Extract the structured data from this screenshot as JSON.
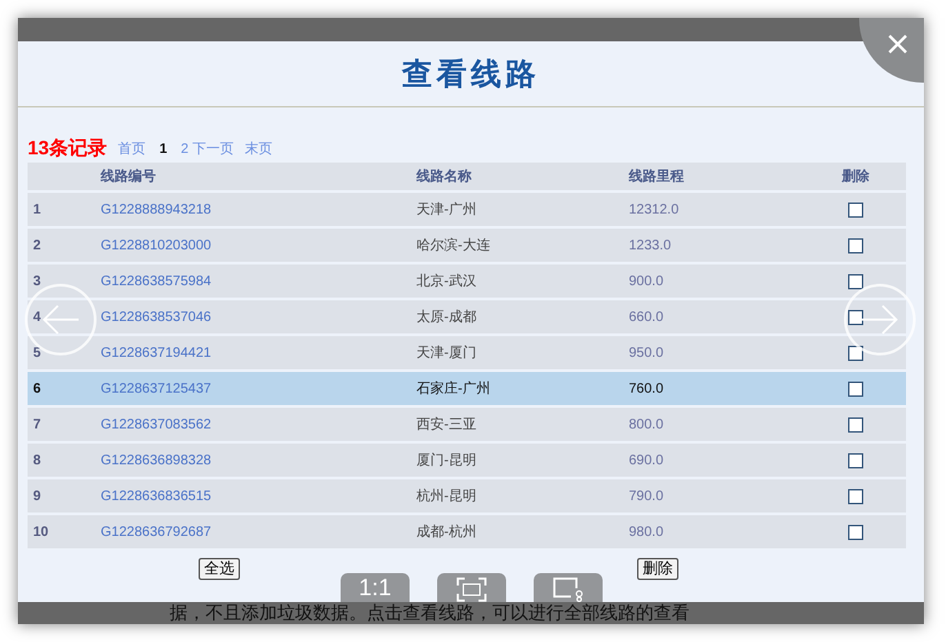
{
  "dialog": {
    "title": "查看线路"
  },
  "pagination": {
    "count": "13条记录",
    "links": [
      {
        "label": "首页",
        "selected": false
      },
      {
        "label": "1",
        "selected": true
      },
      {
        "label": "2 下一页",
        "selected": false
      },
      {
        "label": "末页",
        "selected": false
      }
    ]
  },
  "table": {
    "columns": [
      "",
      "线路编号",
      "线路名称",
      "线路里程",
      "删除"
    ],
    "rows": [
      {
        "index": "1",
        "code": "G1228888943218",
        "name": "天津-广州",
        "distance": "12312.0",
        "checked": false,
        "selected": false
      },
      {
        "index": "2",
        "code": "G1228810203000",
        "name": "哈尔滨-大连",
        "distance": "1233.0",
        "checked": false,
        "selected": false
      },
      {
        "index": "3",
        "code": "G1228638575984",
        "name": "北京-武汉",
        "distance": "900.0",
        "checked": false,
        "selected": false
      },
      {
        "index": "4",
        "code": "G1228638537046",
        "name": "太原-成都",
        "distance": "660.0",
        "checked": false,
        "selected": false
      },
      {
        "index": "5",
        "code": "G1228637194421",
        "name": "天津-厦门",
        "distance": "950.0",
        "checked": false,
        "selected": false
      },
      {
        "index": "6",
        "code": "G1228637125437",
        "name": "石家庄-广州",
        "distance": "760.0",
        "checked": false,
        "selected": true
      },
      {
        "index": "7",
        "code": "G1228637083562",
        "name": "西安-三亚",
        "distance": "800.0",
        "checked": false,
        "selected": false
      },
      {
        "index": "8",
        "code": "G1228636898328",
        "name": "厦门-昆明",
        "distance": "690.0",
        "checked": false,
        "selected": false
      },
      {
        "index": "9",
        "code": "G1228636836515",
        "name": "杭州-昆明",
        "distance": "790.0",
        "checked": false,
        "selected": false
      },
      {
        "index": "10",
        "code": "G1228636792687",
        "name": "成都-杭州",
        "distance": "980.0",
        "checked": false,
        "selected": false
      }
    ]
  },
  "buttons": {
    "select_all": "全选",
    "delete": "删除"
  },
  "viewer": {
    "actual_size": "1:1"
  },
  "background_text": "据，不且添加垃圾数据。点击查看线路，可以进行全部线路的查看"
}
